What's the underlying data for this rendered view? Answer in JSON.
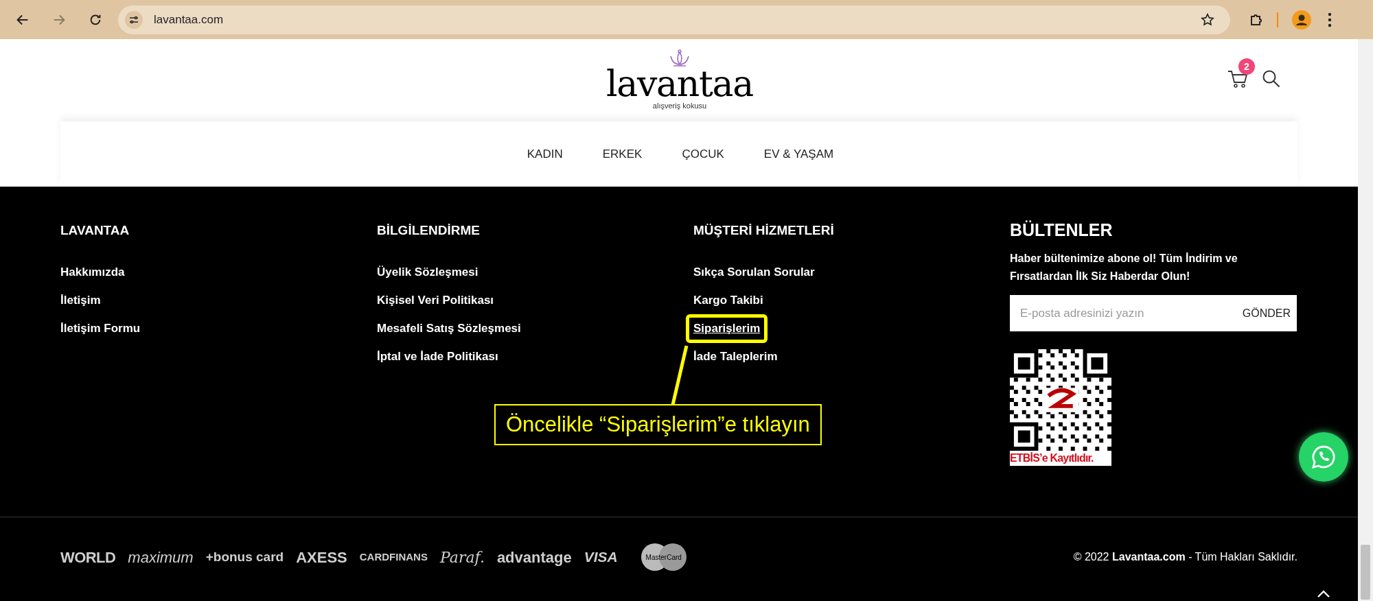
{
  "browser": {
    "url": "lavantaa.com"
  },
  "header": {
    "logo": "lavantaa",
    "tagline": "alışveriş kokusu",
    "cart_count": "2"
  },
  "nav": [
    "KADIN",
    "ERKEK",
    "ÇOCUK",
    "EV & YAŞAM"
  ],
  "footer": {
    "columns": [
      {
        "title": "LAVANTAA",
        "links": [
          {
            "label": "Hakkımızda",
            "highlighted": false
          },
          {
            "label": "İletişim",
            "highlighted": false
          },
          {
            "label": "İletişim Formu",
            "highlighted": false
          }
        ]
      },
      {
        "title": "BİLGİLENDİRME",
        "links": [
          {
            "label": "Üyelik Sözleşmesi",
            "highlighted": false
          },
          {
            "label": "Kişisel Veri Politikası",
            "highlighted": false
          },
          {
            "label": "Mesafeli Satış Sözleşmesi",
            "highlighted": false
          },
          {
            "label": "İptal ve İade Politikası",
            "highlighted": false
          }
        ]
      },
      {
        "title": "MÜŞTERİ HİZMETLERİ",
        "links": [
          {
            "label": "Sıkça Sorulan Sorular",
            "highlighted": false
          },
          {
            "label": "Kargo Takibi",
            "highlighted": false
          },
          {
            "label": "Siparişlerim",
            "highlighted": true
          },
          {
            "label": "İade Taleplerim",
            "highlighted": false
          }
        ]
      }
    ],
    "newsletter": {
      "title": "BÜLTENLER",
      "text": "Haber bültenimize abone ol! Tüm İndirim ve Fırsatlardan İlk Siz Haberdar Olun!",
      "placeholder": "E-posta adresinizi yazın",
      "button": "GÖNDER"
    },
    "etbis_label": "ETBİS’e Kayıtlıdır.",
    "payment_logos": [
      {
        "text": "WORLD",
        "kind": "word"
      },
      {
        "text": "maximum",
        "kind": "word"
      },
      {
        "text": "+bonus card",
        "kind": "word"
      },
      {
        "text": "AXESS",
        "kind": "word"
      },
      {
        "text": "CARDFINANS",
        "kind": "word"
      },
      {
        "text": "Paraf.",
        "kind": "word"
      },
      {
        "text": "advantage",
        "kind": "word"
      },
      {
        "text": "VISA",
        "kind": "word"
      },
      {
        "text": "MasterCard",
        "kind": "circles"
      }
    ],
    "copyright": "© 2022 **Lavantaa.com** - Tüm Hakları Saklıdır."
  },
  "annotation": {
    "text": "Öncelikle “Siparişlerim”e tıklayın"
  }
}
